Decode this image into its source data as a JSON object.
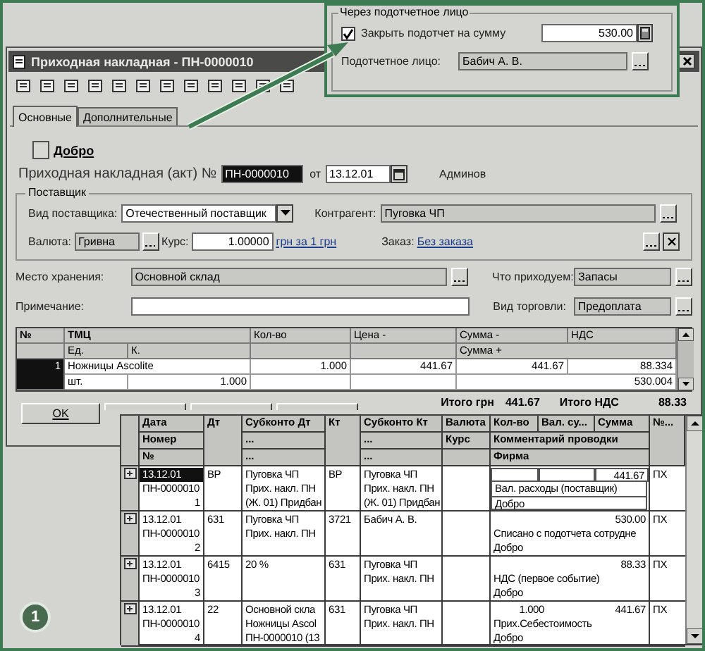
{
  "main_window": {
    "title": "Приходная накладная - ПН-0000010",
    "tabs": [
      {
        "label": "Основные",
        "selected": true
      },
      {
        "label": "Дополнительные",
        "selected": false
      }
    ],
    "firm": "Добро",
    "document": {
      "label": "Приходная накладная (акт) №",
      "number": "ПН-0000010",
      "date_label": "от",
      "date": "13.12.01",
      "author": "Админов"
    },
    "supplier_group": {
      "title": "Поставщик",
      "supplier_type": {
        "label": "Вид поставщика:",
        "value": "Отечественный поставщик"
      },
      "counterparty": {
        "label": "Контрагент:",
        "value": "Пуговка ЧП"
      },
      "currency": {
        "label": "Валюта:",
        "value": "Гривна"
      },
      "rate": {
        "label": "Курс:",
        "value": "1.00000",
        "link": "грн за 1 грн"
      },
      "order": {
        "label": "Заказ:",
        "link": "Без заказа"
      }
    },
    "storage": {
      "label": "Место хранения:",
      "value": "Основной склад"
    },
    "receiving": {
      "label": "Что приходуем:",
      "value": "Запасы"
    },
    "note": {
      "label": "Примечание:"
    },
    "trade_type": {
      "label": "Вид торговли:",
      "value": "Предоплата"
    },
    "items_table": {
      "header": {
        "no": "№",
        "item": "ТМЦ",
        "unit": "Ед.",
        "coef": "К.",
        "qty": "Кол-во",
        "price": "Цена -",
        "sum_minus": "Сумма -",
        "vat": "НДС",
        "sum_plus": "Сумма +"
      },
      "rows": [
        {
          "selected": true,
          "no": "1",
          "item": "Ножницы Ascolite",
          "unit": "шт.",
          "coef": "1.000",
          "qty": "1.000",
          "price": "441.67",
          "sum_minus": "441.67",
          "vat": "88.334",
          "sum_plus": "530.004"
        }
      ]
    },
    "totals": [
      {
        "label": "Итого грн",
        "value": "441.67"
      },
      {
        "label": "Итого НДС",
        "value": "88.33"
      }
    ],
    "buttons": [
      "OK"
    ]
  },
  "accountable_panel": {
    "title": "Через подотчетное лицо",
    "close_checkbox": {
      "label": "Закрыть подотчет на сумму",
      "checked": true
    },
    "amount": "530.00",
    "person": {
      "label": "Подотчетное лицо:",
      "value": "Бабич А. В."
    }
  },
  "journal": {
    "header": {
      "date": [
        "Дата",
        "Номер",
        "№"
      ],
      "dt": "Дт",
      "sub_dt": [
        "Субконто Дт",
        "...",
        "..."
      ],
      "kt": "Кт",
      "sub_kt": [
        "Субконто Кт",
        "...",
        "..."
      ],
      "currency": [
        "Валюта",
        "Курс"
      ],
      "amounts": [
        "Кол-во",
        "Вал. су...",
        "Сумма"
      ],
      "comment": "Комментарий проводки",
      "firm": "Фирма",
      "journal": "№..."
    },
    "rows": [
      {
        "selected": true,
        "date": "13.12.01",
        "number": "ПН-0000010",
        "line": "1",
        "dt": "ВР",
        "sub_dt": [
          "Пуговка ЧП",
          "Прих. накл. ПН",
          "(Ж. 01) Придбан"
        ],
        "kt": "ВР",
        "sub_kt": [
          "Пуговка ЧП",
          "Прих. накл. ПН",
          "(Ж. 01) Придбан"
        ],
        "amount": "441.67",
        "comment": "Вал. расходы (поставщик)",
        "firm": "Добро",
        "journal": "ПХ"
      },
      {
        "selected": false,
        "date": "13.12.01",
        "number": "ПН-0000010",
        "line": "2",
        "dt": "631",
        "sub_dt": [
          "Пуговка ЧП",
          "Прих. накл. ПН"
        ],
        "kt": "3721",
        "sub_kt": [
          "Бабич А. В."
        ],
        "amount": "530.00",
        "comment": "Списано с подотчета сотрудне",
        "firm": "Добро",
        "journal": "ПХ"
      },
      {
        "selected": false,
        "date": "13.12.01",
        "number": "ПН-0000010",
        "line": "3",
        "dt": "6415",
        "sub_dt": [
          "20 %"
        ],
        "kt": "631",
        "sub_kt": [
          "Пуговка ЧП",
          "Прих. накл. ПН"
        ],
        "amount": "88.33",
        "comment": "НДС (первое событие)",
        "firm": "Добро",
        "journal": "ПХ"
      },
      {
        "selected": false,
        "date": "13.12.01",
        "number": "ПН-0000010",
        "line": "4",
        "dt": "22",
        "sub_dt": [
          "Основной скла",
          "Ножницы Ascol",
          "ПН-0000010 (13"
        ],
        "kt": "631",
        "sub_kt": [
          "Пуговка ЧП",
          "Прих. накл. ПН"
        ],
        "qty": "1.000",
        "amount": "441.67",
        "comment": "Прих.Себестоимость",
        "firm": "Добро",
        "journal": "ПХ"
      }
    ]
  },
  "callout": "1"
}
